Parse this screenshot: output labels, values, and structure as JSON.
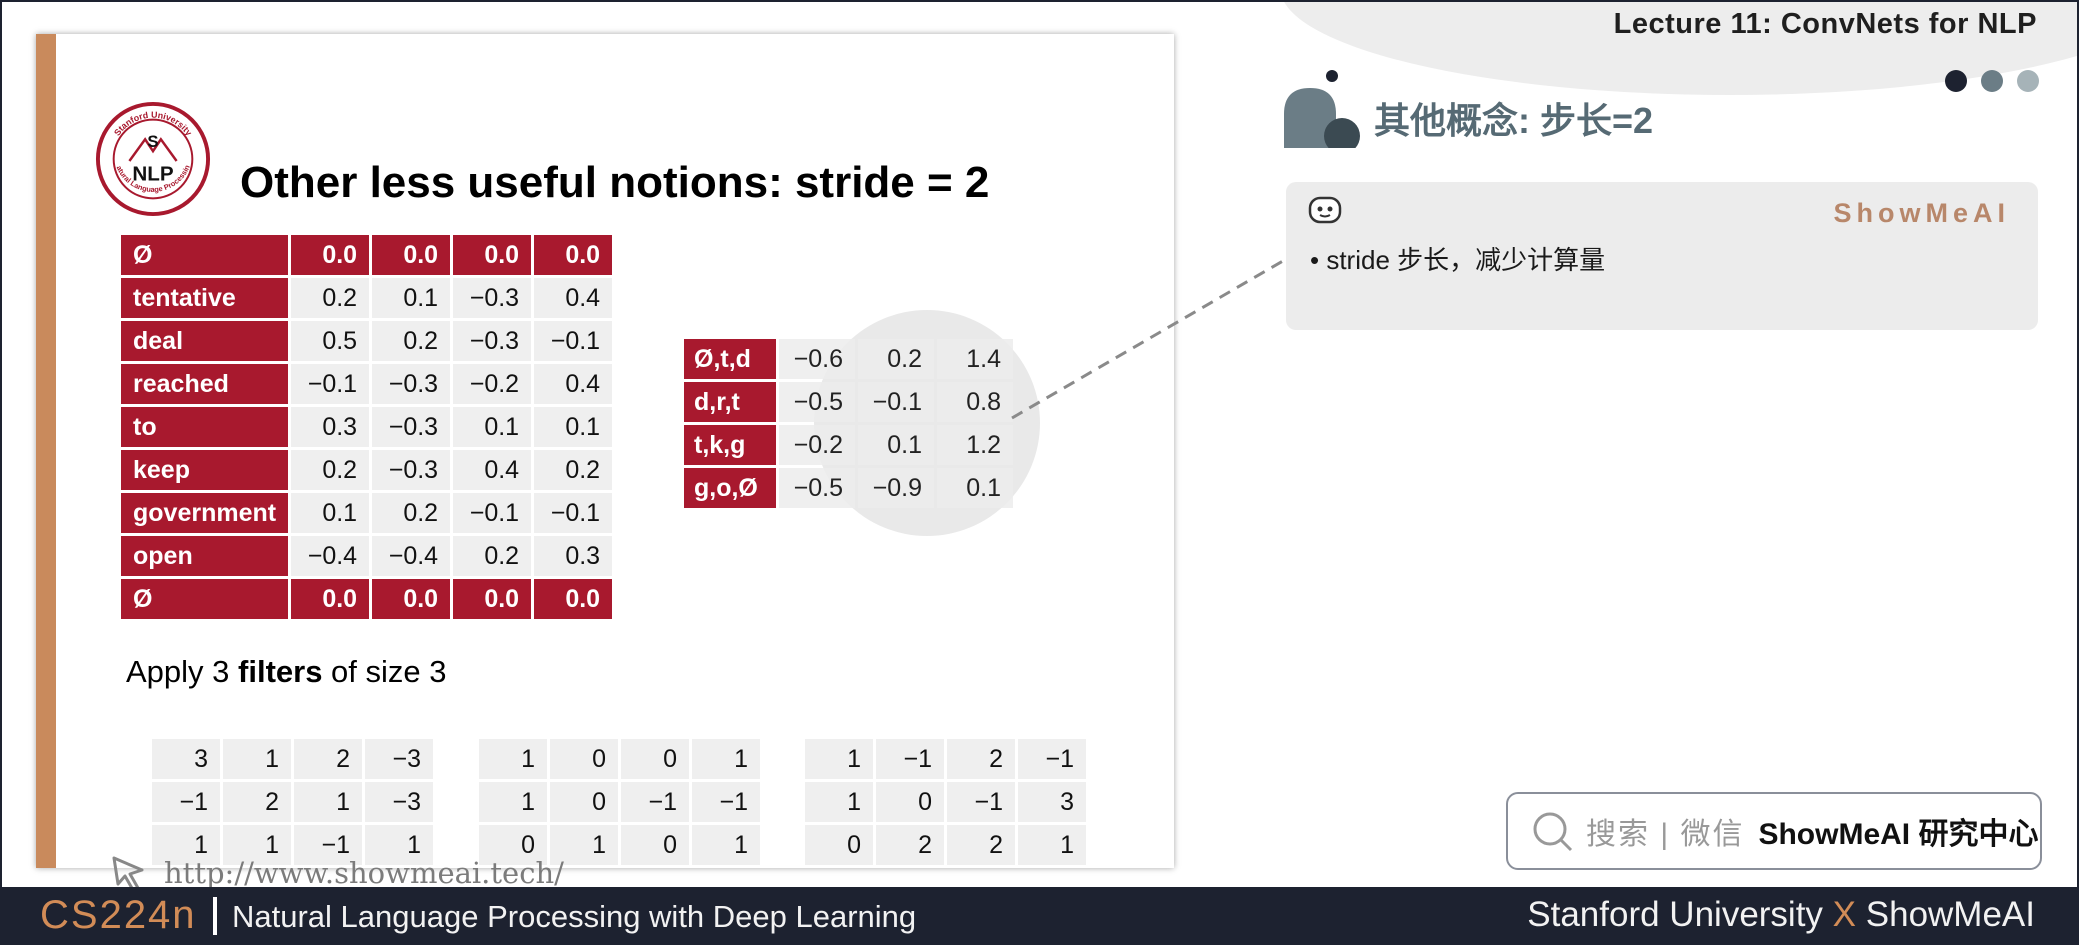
{
  "header": {
    "lecture_title": "Lecture 11: ConvNets for NLP",
    "dot_colors": [
      "#1d2230",
      "#6b7d86",
      "#a6b3b8"
    ]
  },
  "slide": {
    "logo": {
      "top_text": "Stanford University",
      "letter_s": "S",
      "letters_nlp": "NLP",
      "bottom_text": "Natural Language Processing"
    },
    "title": "Other less useful notions: stride = 2",
    "input_table": {
      "rows": [
        {
          "label": "Ø",
          "values": [
            "0.0",
            "0.0",
            "0.0",
            "0.0"
          ],
          "pad": true
        },
        {
          "label": "tentative",
          "values": [
            "0.2",
            "0.1",
            "−0.3",
            "0.4"
          ]
        },
        {
          "label": "deal",
          "values": [
            "0.5",
            "0.2",
            "−0.3",
            "−0.1"
          ]
        },
        {
          "label": "reached",
          "values": [
            "−0.1",
            "−0.3",
            "−0.2",
            "0.4"
          ]
        },
        {
          "label": "to",
          "values": [
            "0.3",
            "−0.3",
            "0.1",
            "0.1"
          ]
        },
        {
          "label": "keep",
          "values": [
            "0.2",
            "−0.3",
            "0.4",
            "0.2"
          ]
        },
        {
          "label": "government",
          "values": [
            "0.1",
            "0.2",
            "−0.1",
            "−0.1"
          ]
        },
        {
          "label": "open",
          "values": [
            "−0.4",
            "−0.4",
            "0.2",
            "0.3"
          ]
        },
        {
          "label": "Ø",
          "values": [
            "0.0",
            "0.0",
            "0.0",
            "0.0"
          ],
          "pad": true
        }
      ]
    },
    "output_table": {
      "rows": [
        {
          "label": "Ø,t,d",
          "values": [
            "−0.6",
            "0.2",
            "1.4"
          ]
        },
        {
          "label": "d,r,t",
          "values": [
            "−0.5",
            "−0.1",
            "0.8"
          ]
        },
        {
          "label": "t,k,g",
          "values": [
            "−0.2",
            "0.1",
            "1.2"
          ]
        },
        {
          "label": "g,o,Ø",
          "values": [
            "−0.5",
            "−0.9",
            "0.1"
          ]
        }
      ]
    },
    "apply": {
      "prefix": "Apply 3 ",
      "bold": "filters",
      "suffix": " of size 3"
    },
    "filters": [
      [
        [
          "3",
          "1",
          "2",
          "−3"
        ],
        [
          "−1",
          "2",
          "1",
          "−3"
        ],
        [
          "1",
          "1",
          "−1",
          "1"
        ]
      ],
      [
        [
          "1",
          "0",
          "0",
          "1"
        ],
        [
          "1",
          "0",
          "−1",
          "−1"
        ],
        [
          "0",
          "1",
          "0",
          "1"
        ]
      ],
      [
        [
          "1",
          "−1",
          "2",
          "−1"
        ],
        [
          "1",
          "0",
          "−1",
          "3"
        ],
        [
          "0",
          "2",
          "2",
          "1"
        ]
      ]
    ],
    "link": "http://www.showmeai.tech/"
  },
  "side": {
    "section_title": "其他概念: 步长=2",
    "brand": "ShowMeAI",
    "note": "•   stride 步长，减少计算量",
    "search": {
      "placeholder": "搜索 | 微信",
      "brand": "ShowMeAI 研究中心"
    }
  },
  "footer": {
    "course": "CS224n",
    "subtitle": "Natural Language Processing with Deep Learning",
    "right_a": "Stanford University ",
    "right_x": "X",
    "right_b": " ShowMeAI"
  },
  "colors": {
    "accent_red": "#a8192e",
    "accent_orange": "#d28c57",
    "footer_bg": "#1d2230",
    "section_title": "#566a74"
  }
}
